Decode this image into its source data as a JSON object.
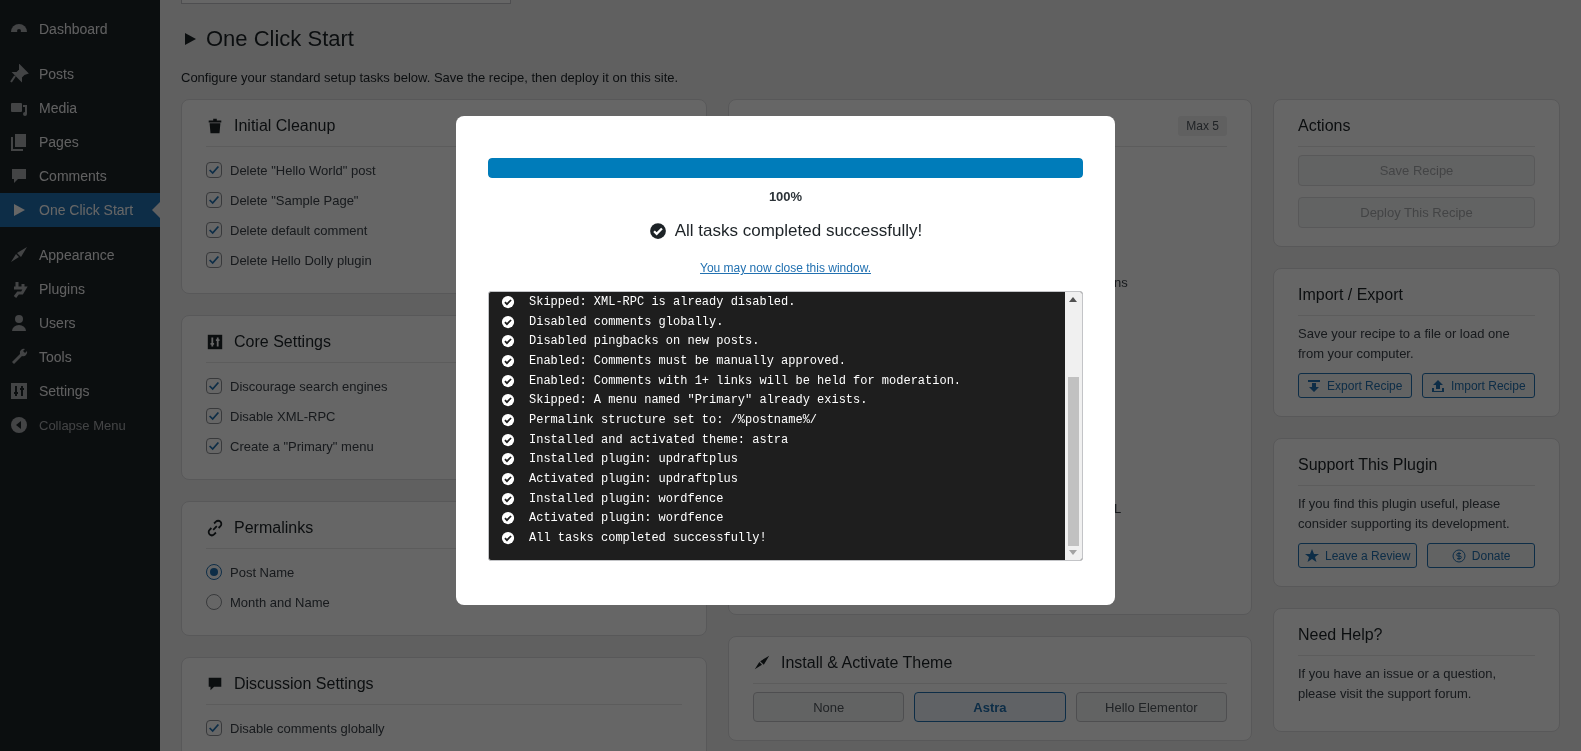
{
  "sidebar": {
    "items": [
      {
        "label": "Dashboard",
        "selected": false
      },
      {
        "label": "Posts",
        "selected": false
      },
      {
        "label": "Media",
        "selected": false
      },
      {
        "label": "Pages",
        "selected": false
      },
      {
        "label": "Comments",
        "selected": false
      },
      {
        "label": "One Click Start",
        "selected": true
      },
      {
        "label": "Appearance",
        "selected": false
      },
      {
        "label": "Plugins",
        "selected": false
      },
      {
        "label": "Users",
        "selected": false
      },
      {
        "label": "Tools",
        "selected": false
      },
      {
        "label": "Settings",
        "selected": false
      }
    ],
    "collapse_label": "Collapse Menu"
  },
  "page": {
    "title": "One Click Start",
    "description": "Configure your standard setup tasks below. Save the recipe, then deploy it on this site."
  },
  "left_cards": [
    {
      "title": "Initial Cleanup",
      "kind": "checkboxes",
      "items": [
        {
          "label": "Delete \"Hello World\" post",
          "checked": true
        },
        {
          "label": "Delete \"Sample Page\"",
          "checked": true
        },
        {
          "label": "Delete default comment",
          "checked": true
        },
        {
          "label": "Delete Hello Dolly plugin",
          "checked": true
        }
      ]
    },
    {
      "title": "Core Settings",
      "kind": "checkboxes",
      "items": [
        {
          "label": "Discourage search engines",
          "checked": true
        },
        {
          "label": "Disable XML-RPC",
          "checked": true
        },
        {
          "label": "Create a \"Primary\" menu",
          "checked": true
        }
      ]
    },
    {
      "title": "Permalinks",
      "kind": "radios",
      "items": [
        {
          "label": "Post Name",
          "selected": true
        },
        {
          "label": "Month and Name",
          "selected": false
        }
      ]
    },
    {
      "title": "Discussion Settings",
      "kind": "checkboxes",
      "items": [
        {
          "label": "Disable comments globally",
          "checked": true
        }
      ]
    }
  ],
  "plugins_card": {
    "badge": "Max 5",
    "fragments": [
      "ns",
      "L"
    ]
  },
  "theme_card": {
    "title": "Install & Activate Theme",
    "options": [
      {
        "label": "None",
        "selected": false
      },
      {
        "label": "Astra",
        "selected": true
      },
      {
        "label": "Hello Elementor",
        "selected": false
      }
    ]
  },
  "actions_card": {
    "title": "Actions",
    "buttons": [
      {
        "label": "Save Recipe",
        "disabled": true
      },
      {
        "label": "Deploy This Recipe",
        "disabled": true
      }
    ]
  },
  "import_export_card": {
    "title": "Import / Export",
    "text": "Save your recipe to a file or load one from your computer.",
    "buttons": [
      "Export Recipe",
      "Import Recipe"
    ]
  },
  "support_card": {
    "title": "Support This Plugin",
    "text": "If you find this plugin useful, please consider supporting its development.",
    "buttons": [
      "Leave a Review",
      "Donate"
    ]
  },
  "help_card": {
    "title": "Need Help?",
    "text": "If you have an issue or a question, please visit the support forum."
  },
  "modal": {
    "progress": {
      "level": 1,
      "label": "100%"
    },
    "status": "All tasks completed successfully!",
    "link": "You may now close this window.",
    "log": [
      "Skipped: XML-RPC is already disabled.",
      "Disabled comments globally.",
      "Disabled pingbacks on new posts.",
      "Enabled: Comments must be manually approved.",
      "Enabled: Comments with 1+ links will be held for moderation.",
      "Skipped: A menu named \"Primary\" already exists.",
      "Permalink structure set to: /%postname%/",
      "Installed and activated theme: astra",
      "Installed plugin: updraftplus",
      "Activated plugin: updraftplus",
      "Installed plugin: wordfence",
      "Activated plugin: wordfence",
      "All tasks completed successfully!"
    ]
  }
}
